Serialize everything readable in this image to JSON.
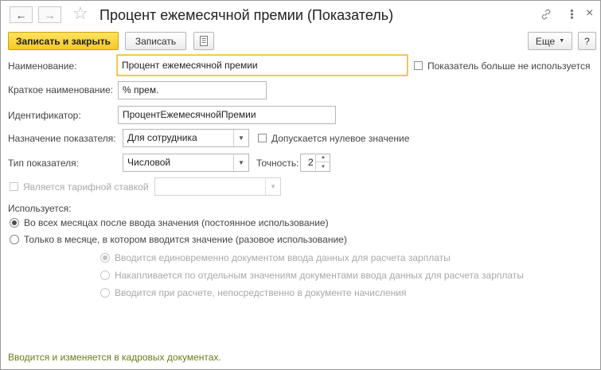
{
  "window": {
    "title": "Процент ежемесячной премии (Показатель)",
    "nav_back_icon": "arrow-left-icon",
    "nav_forward_icon": "arrow-right-icon",
    "star_icon": "star-icon",
    "link_icon": "link-icon",
    "more_icon": "vertical-dots-icon",
    "close_icon": "close-icon"
  },
  "toolbar": {
    "save_close_label": "Записать и закрыть",
    "save_label": "Записать",
    "doc_icon": "document-icon",
    "more_label": "Еще",
    "help_label": "?"
  },
  "form": {
    "name_label": "Наименование:",
    "name_value": "Процент ежемесячной премии",
    "not_used_label": "Показатель больше не используется",
    "short_name_label": "Краткое наименование:",
    "short_name_value": "% прем.",
    "identifier_label": "Идентификатор:",
    "identifier_value": "ПроцентЕжемесячнойПремии",
    "purpose_label": "Назначение показателя:",
    "purpose_value": "Для сотрудника",
    "zero_allowed_label": "Допускается нулевое значение",
    "type_label": "Тип показателя:",
    "type_value": "Числовой",
    "precision_label": "Точность:",
    "precision_value": "2",
    "tariff_label": "Является тарифной ставкой",
    "tariff_value": ""
  },
  "usage": {
    "label": "Используется:",
    "option_constant": "Во всех месяцах после ввода значения (постоянное использование)",
    "option_once": "Только в месяце, в котором вводится значение (разовое использование)",
    "sub_option_1": "Вводится единовременно документом ввода данных для расчета зарплаты",
    "sub_option_2": "Накапливается по отдельным значениям документами ввода данных для расчета зарплаты",
    "sub_option_3": "Вводится при расчете, непосредственно в документе начисления"
  },
  "footer": {
    "text": "Вводится и изменяется в кадровых документах."
  },
  "colors": {
    "primary_button": "#f5c928",
    "footer_text": "#6e7a19",
    "focus_border": "#f0c02c"
  }
}
